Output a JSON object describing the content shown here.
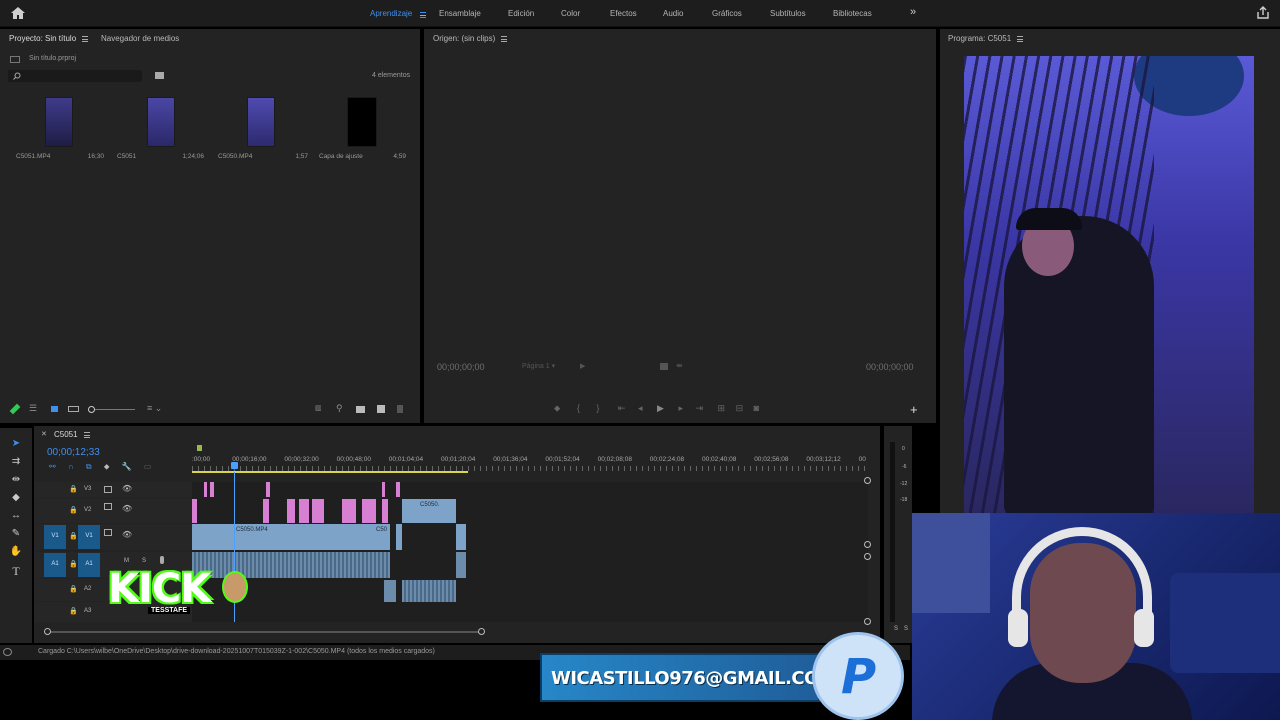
{
  "workspaces": [
    {
      "label": "Aprendizaje",
      "active": true
    },
    {
      "label": "Ensamblaje",
      "active": false
    },
    {
      "label": "Edición",
      "active": false
    },
    {
      "label": "Color",
      "active": false
    },
    {
      "label": "Efectos",
      "active": false
    },
    {
      "label": "Audio",
      "active": false
    },
    {
      "label": "Gráficos",
      "active": false
    },
    {
      "label": "Subtítulos",
      "active": false
    },
    {
      "label": "Bibliotecas",
      "active": false
    }
  ],
  "project": {
    "tab_active": "Proyecto: Sin título",
    "tab_other": "Navegador de medios",
    "file": "Sin título.prproj",
    "count": "4 elementos",
    "items": [
      {
        "name": "C5051.MP4",
        "duration": "16;30"
      },
      {
        "name": "C5051",
        "duration": "1;24;06"
      },
      {
        "name": "C5050.MP4",
        "duration": "1;57"
      },
      {
        "name": "Capa de ajuste",
        "duration": "4;59"
      }
    ]
  },
  "source": {
    "title": "Origen: (sin clips)",
    "tc_left": "00;00;00;00",
    "page": "Página 1",
    "tc_right": "00;00;00;00"
  },
  "program": {
    "title": "Programa: C5051"
  },
  "timeline": {
    "seq_tab": "C5051",
    "timecode": "00;00;12;33",
    "ruler": [
      ":00;00",
      "00;00;16;00",
      "00;00;32;00",
      "00;00;48;00",
      "00;01;04;04",
      "00;01;20;04",
      "00;01;36;04",
      "00;01;52;04",
      "00;02;08;08",
      "00;02;24;08",
      "00;02;40;08",
      "00;02;56;08",
      "00;03;12;12",
      "00"
    ],
    "tracks": {
      "v3": "V3",
      "v2": "V2",
      "v1": "V1",
      "a1": "A1",
      "a2": "A2",
      "a3": "A3",
      "v1_src": "V1",
      "a1_src": "A1",
      "m": "M",
      "s": "S"
    },
    "clip_labels": {
      "c5050_v1": "C5050.MP4",
      "c50_v1": "C50",
      "c5050_v2": "C5050."
    }
  },
  "meter": {
    "labels": [
      "0",
      "-6",
      "-12",
      "-18"
    ],
    "bottom": [
      "S",
      "S"
    ]
  },
  "status": "Cargado C:\\Users\\wilbe\\OneDrive\\Desktop\\drive-download-20251007T015039Z-1-002\\C5050.MP4 (todos los medios cargados)",
  "overlay": {
    "kick_text": "KICK",
    "kick_sub": "TESSTAFE",
    "email": "WICASTILLO976@GMAIL.COM"
  },
  "colors": {
    "accent": "#3d8ff0",
    "pink_clip": "#d77fd3",
    "blue_clip": "#7ea3c8",
    "kick_green": "#53fc18",
    "paypal_blue": "#1d6fd8"
  }
}
